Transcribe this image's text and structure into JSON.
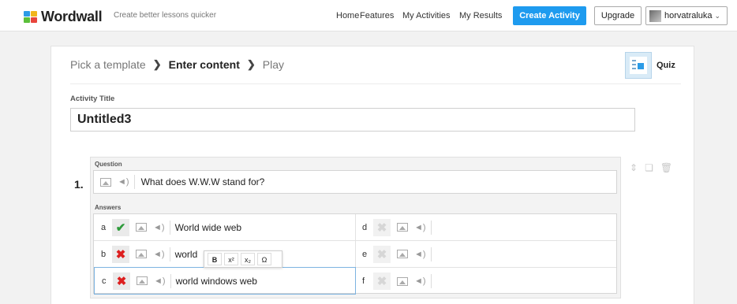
{
  "header": {
    "logo": "Wordwall",
    "tagline": "Create better lessons quicker",
    "nav": [
      "Home",
      "Features",
      "My Activities",
      "My Results"
    ],
    "create_label": "Create Activity",
    "upgrade_label": "Upgrade",
    "username": "horvatraluka",
    "accent": "#1e9bef"
  },
  "breadcrumb": {
    "step1": "Pick a template",
    "step2": "Enter content",
    "step3": "Play",
    "template_name": "Quiz"
  },
  "form": {
    "title_label": "Activity Title",
    "title_value": "Untitled3"
  },
  "question": {
    "number": "1.",
    "label": "Question",
    "text": "What does W.W.W stand for?",
    "answers_label": "Answers",
    "answers": [
      {
        "letter": "a",
        "text": "World wide web",
        "correct": true
      },
      {
        "letter": "b",
        "text": "world",
        "correct": false
      },
      {
        "letter": "c",
        "text": "world windows web",
        "correct": false
      },
      {
        "letter": "d",
        "text": "",
        "correct": null
      },
      {
        "letter": "e",
        "text": "",
        "correct": null
      },
      {
        "letter": "f",
        "text": "",
        "correct": null
      }
    ]
  },
  "format_toolbar": {
    "bold": "B",
    "superscript": "x²",
    "subscript": "x₂",
    "symbol": "Ω"
  }
}
